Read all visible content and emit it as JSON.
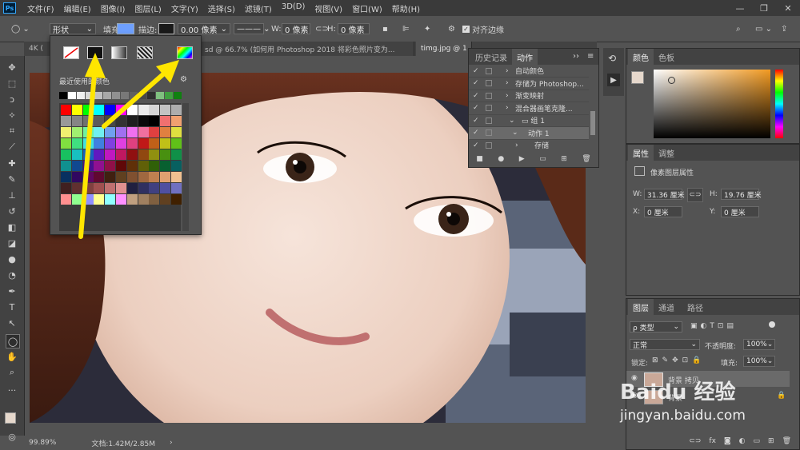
{
  "app": {
    "logo": "Ps"
  },
  "menu": [
    "文件(F)",
    "编辑(E)",
    "图像(I)",
    "图层(L)",
    "文字(Y)",
    "选择(S)",
    "滤镜(T)",
    "3D(D)",
    "视图(V)",
    "窗口(W)",
    "帮助(H)"
  ],
  "window_controls": {
    "minimize": "—",
    "maximize": "❐",
    "close": "✕"
  },
  "options": {
    "mode": "形状",
    "fill_label": "填充:",
    "fill_color": "#6ea0ff",
    "stroke_label": "描边:",
    "stroke_width": "0.00 像素",
    "w_label": "W:",
    "w_value": "0 像素",
    "h_label": "H:",
    "h_value": "0 像素",
    "align_edges": "对齐边缘"
  },
  "tabs": [
    "4K (",
    "sd @ 66.7% (如何用 Photoshop 2018 将彩色照片变为...",
    "timg.jpg @ 1"
  ],
  "swatch_popup": {
    "recent_label": "最近使用的颜色",
    "recent_colors": [
      "#000000",
      "#ffffff",
      "#f0f0f0",
      "#d8d8d8",
      "#c0c0c0",
      "#a8a8a8",
      "#909090",
      "#787878",
      "#606060",
      "#484848",
      "#303030",
      "#80c080",
      "#40a040",
      "#108010"
    ],
    "grid_colors": [
      [
        "#ff0000",
        "#ffff00",
        "#00ff00",
        "#00ffff",
        "#0000ff",
        "#ff00ff",
        "#ffffff",
        "#ebebeb",
        "#d6d6d6",
        "#c2c2c2",
        "#adadad"
      ],
      [
        "#999999",
        "#858585",
        "#707070",
        "#5c5c5c",
        "#474747",
        "#333333",
        "#1f1f1f",
        "#0a0a0a",
        "#000000",
        "#f07070",
        "#f0a070"
      ],
      [
        "#f0f070",
        "#a0f070",
        "#70f0a0",
        "#70f0f0",
        "#70a0f0",
        "#a070f0",
        "#f070f0",
        "#f070a0",
        "#e04040",
        "#e08040",
        "#e0e040"
      ],
      [
        "#80e040",
        "#40e080",
        "#40e0e0",
        "#4080e0",
        "#8040e0",
        "#e040e0",
        "#e04080",
        "#c01818",
        "#c06018",
        "#c0c018",
        "#60c018"
      ],
      [
        "#18c060",
        "#18c0c0",
        "#1860c0",
        "#6018c0",
        "#c018c0",
        "#c01860",
        "#901010",
        "#904810",
        "#909010",
        "#489010",
        "#109048"
      ],
      [
        "#109090",
        "#104890",
        "#481090",
        "#901090",
        "#901048",
        "#600808",
        "#603008",
        "#606008",
        "#306008",
        "#086030",
        "#086060"
      ],
      [
        "#083060",
        "#300860",
        "#600860",
        "#600830",
        "#402010",
        "#604020",
        "#805030",
        "#a06840",
        "#c08050",
        "#e0a070",
        "#f0c090"
      ],
      [
        "#402020",
        "#603030",
        "#804040",
        "#a05050",
        "#c07070",
        "#e09090",
        "#202040",
        "#303060",
        "#404080",
        "#5050a0",
        "#7070c0"
      ],
      [
        "#ff9090",
        "#90ff90",
        "#9090ff",
        "#ffff90",
        "#90ffff",
        "#ff90ff",
        "#c0a080",
        "#a08060",
        "#806040",
        "#604020",
        "#402000"
      ]
    ]
  },
  "history_actions": {
    "tab_history": "历史记录",
    "tab_actions": "动作",
    "rows": [
      {
        "check": "✓",
        "label": "自动颜色",
        "indent": 0
      },
      {
        "check": "✓",
        "label": "存储为 Photoshop...",
        "indent": 0
      },
      {
        "check": "✓",
        "label": "渐变映射",
        "indent": 0
      },
      {
        "check": "✓",
        "label": "混合器画笔克隆...",
        "indent": 0
      },
      {
        "check": "✓",
        "label": "组 1",
        "indent": 1
      },
      {
        "check": "✓",
        "label": "动作 1",
        "indent": 2
      },
      {
        "check": "✓",
        "label": "存储",
        "indent": 3
      }
    ]
  },
  "color_panel": {
    "tab_color": "颜色",
    "tab_swatches": "色板",
    "hue_color": "#f29a22"
  },
  "properties": {
    "tab_props": "属性",
    "tab_adjust": "调整",
    "type_label": "像素图层属性",
    "w_label": "W:",
    "w_value": "31.36 厘米",
    "h_label": "H:",
    "h_value": "19.76 厘米",
    "x_label": "X:",
    "x_value": "0 厘米",
    "y_label": "Y:",
    "y_value": "0 厘米"
  },
  "layers": {
    "tab_layers": "图层",
    "tab_channels": "通道",
    "tab_paths": "路径",
    "filter_label": "ρ 类型",
    "blend_mode": "正常",
    "opacity_label": "不透明度:",
    "opacity_value": "100%",
    "lock_label": "锁定:",
    "fill_label": "填充:",
    "fill_value": "100%",
    "layer1_name": "背景 拷贝",
    "layer2_name": "背景"
  },
  "status": {
    "zoom": "99.89%",
    "doc": "文档:1.42M/2.85M"
  },
  "watermark": {
    "text": "Baidu 经验",
    "url": "jingyan.baidu.com"
  }
}
